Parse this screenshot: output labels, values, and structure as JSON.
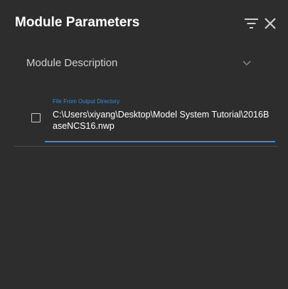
{
  "panel": {
    "title": "Module Parameters",
    "icons": {
      "filter": "filter-icon",
      "close": "close-icon"
    },
    "description": {
      "label": "Module Description",
      "icon": "chevron-down-icon"
    }
  },
  "parameters": [
    {
      "label": "File From Output Directory",
      "value": "C:\\Users\\xiyang\\Desktop\\Model System Tutorial\\2016BaseNCS16.nwp",
      "checked": false
    }
  ],
  "colors": {
    "background": "#2d2d2d",
    "accent": "#2f8fe0",
    "text": "#ffffff",
    "muted": "#cfcfcf"
  }
}
